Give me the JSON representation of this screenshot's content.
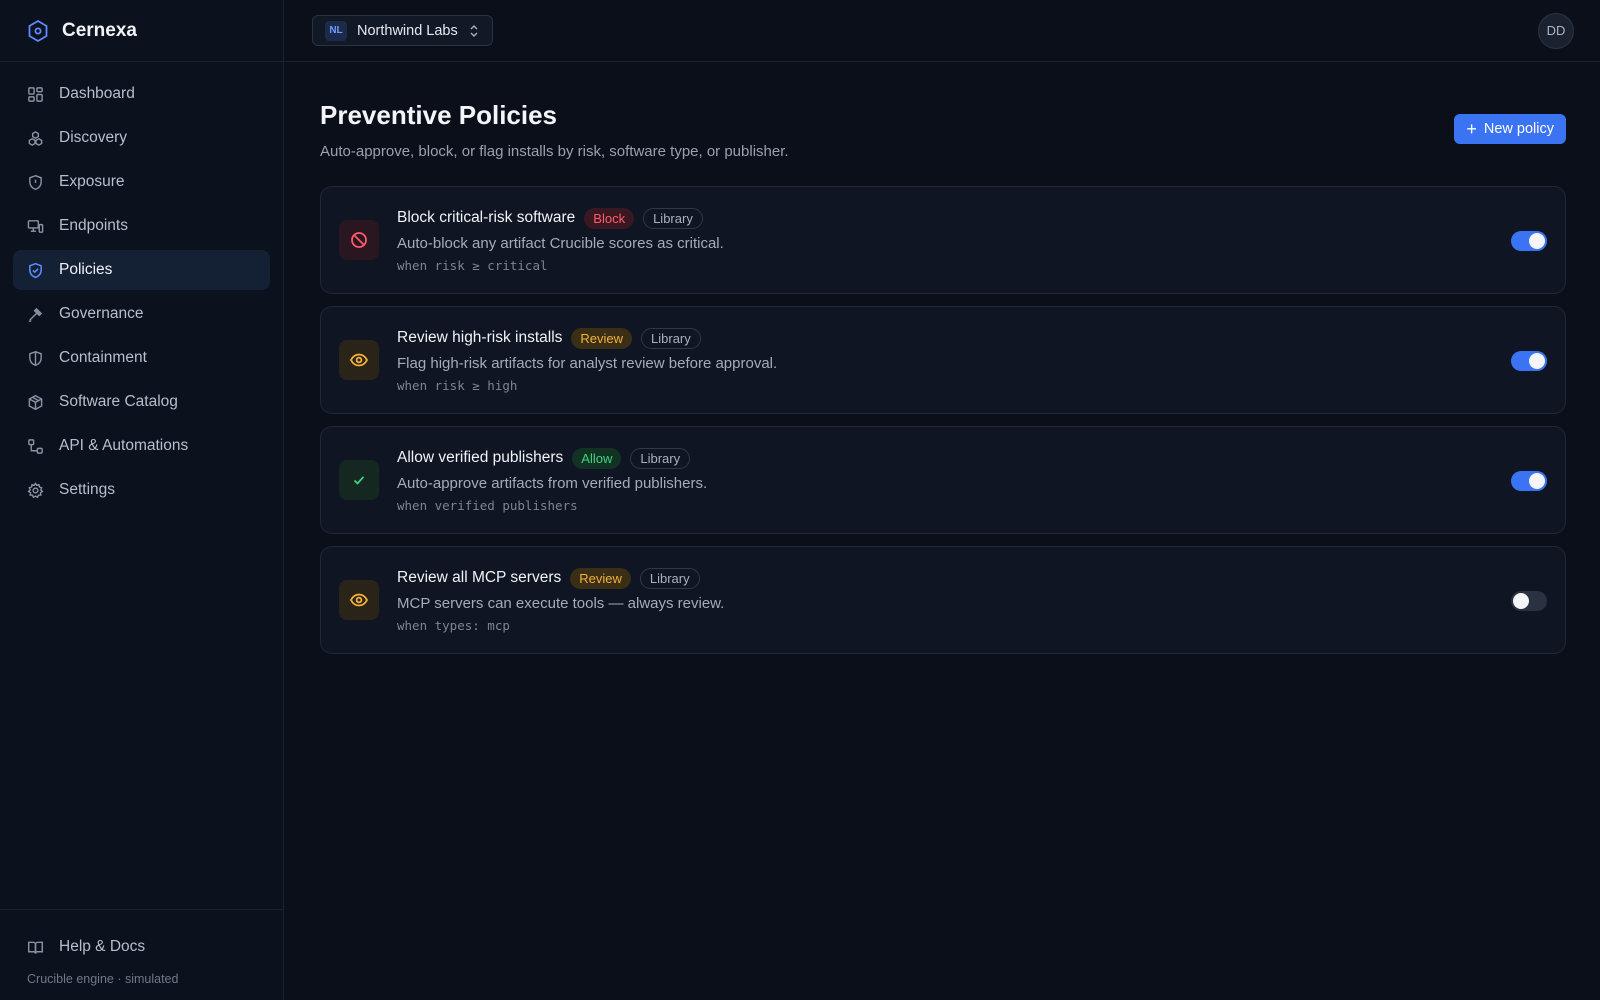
{
  "brand": {
    "name": "Cernexa",
    "accent": "#5b8cff"
  },
  "sidebar": {
    "items": [
      {
        "label": "Dashboard",
        "icon": "grid-icon",
        "active": false
      },
      {
        "label": "Discovery",
        "icon": "cubes-icon",
        "active": false
      },
      {
        "label": "Exposure",
        "icon": "shield-alert-icon",
        "active": false
      },
      {
        "label": "Endpoints",
        "icon": "monitor-icon",
        "active": false
      },
      {
        "label": "Policies",
        "icon": "shield-check-icon",
        "active": true
      },
      {
        "label": "Governance",
        "icon": "gavel-icon",
        "active": false
      },
      {
        "label": "Containment",
        "icon": "shield-half-icon",
        "active": false
      },
      {
        "label": "Software Catalog",
        "icon": "package-icon",
        "active": false
      },
      {
        "label": "API & Automations",
        "icon": "workflow-icon",
        "active": false
      },
      {
        "label": "Settings",
        "icon": "gear-icon",
        "active": false
      }
    ],
    "help_label": "Help & Docs",
    "engine_text": "Crucible engine · simulated"
  },
  "topbar": {
    "org_badge": "NL",
    "org_name": "Northwind Labs",
    "avatar": "DD"
  },
  "page": {
    "title": "Preventive Policies",
    "subtitle": "Auto-approve, block, or flag installs by risk, software type, or publisher.",
    "new_button": "New policy"
  },
  "policies": [
    {
      "title": "Block critical-risk software",
      "action": "Block",
      "action_kind": "block",
      "source": "Library",
      "description": "Auto-block any artifact Crucible scores as critical.",
      "condition": "when risk ≥ critical",
      "enabled": true,
      "icon": "ban-icon"
    },
    {
      "title": "Review high-risk installs",
      "action": "Review",
      "action_kind": "review",
      "source": "Library",
      "description": "Flag high-risk artifacts for analyst review before approval.",
      "condition": "when risk ≥ high",
      "enabled": true,
      "icon": "eye-icon"
    },
    {
      "title": "Allow verified publishers",
      "action": "Allow",
      "action_kind": "allow",
      "source": "Library",
      "description": "Auto-approve artifacts from verified publishers.",
      "condition": "when verified publishers",
      "enabled": true,
      "icon": "check-icon"
    },
    {
      "title": "Review all MCP servers",
      "action": "Review",
      "action_kind": "review",
      "source": "Library",
      "description": "MCP servers can execute tools — always review.",
      "condition": "when types: mcp",
      "enabled": false,
      "icon": "eye-icon"
    }
  ],
  "colors": {
    "block": "#ff5b6e",
    "review": "#f4b13e",
    "allow": "#3fd37f",
    "toggle_on": "#3b74f2"
  }
}
